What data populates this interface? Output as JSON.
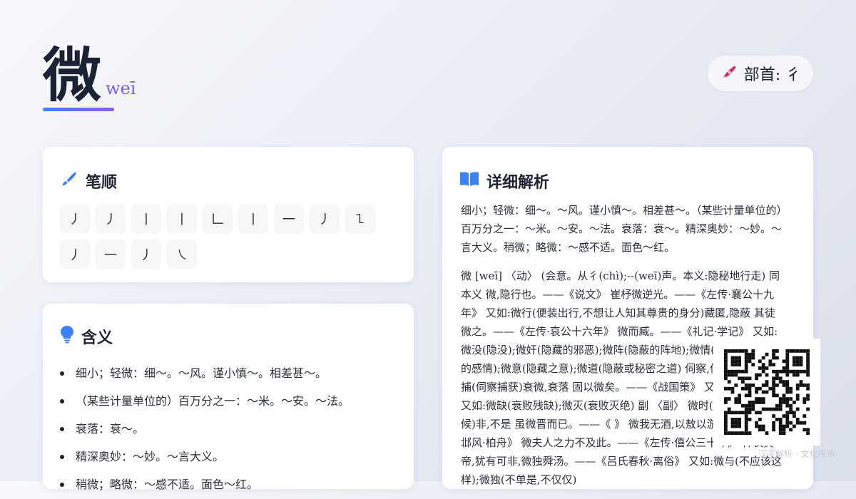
{
  "header": {
    "character": "微",
    "pinyin": "weī",
    "radical_label": "部首: 彳"
  },
  "stroke_order": {
    "title": "笔顺",
    "strokes": [
      "丿",
      "丿",
      "丨",
      "丨",
      "𠃊",
      "丨",
      "一",
      "丿",
      "㇅",
      "丿",
      "一",
      "丿",
      "㇏"
    ]
  },
  "meanings": {
    "title": "含义",
    "items": [
      "细小；轻微：细～。～风。谨小慎～。相差甚～。",
      "（某些计量单位的）百万分之一：～米。～安。～法。",
      "衰落：衰～。",
      "精深奥妙：～妙。～言大义。",
      "稍微；略微：～感不适。面色～红。"
    ]
  },
  "detail": {
    "title": "详细解析",
    "para1": "细小；轻微：细～。～风。谨小慎～。相差甚～。（某些计量单位的）百万分之一：～米。～安。～法。衰落：衰～。精深奥妙：～妙。～言大义。稍微；略微：～感不适。面色～红。",
    "para2": "微 [weī] 〈动〉 (会意。从彳(chì);--(weī)声。本义:隐秘地行走) 同本义 微,隐行也。——《说文》 崔杼微逆光。——《左传·襄公十九年》 又如:微行(便装出行,不想让人知其尊贵的身分)藏匿,隐蔽 其徒微之。——《左传·哀公十六年》 微而臧。——《礼记·学记》 又如:微没(隐没);微奸(隐藏的邪恶);微阵(隐蔽的阵地);微情(隐藏而不显露的感情);微意(隐藏之意);微道(隐蔽或秘密之道) 伺察,侦察 。 如:微捕(伺察捕获)衰微,衰落 固以微矣。——《战国策》 又:弑《教战守》 又如:微缺(衰败残缺);微灭(衰败灭绝) 副 〈副〉 微时(尚未出名的时候)非,不是 虽微晋而已。——《 》 微我无酒,以敖以游。——《诗·邶风·柏舟》 微夫人之力不及此。——《左传·僖公三十年》 神农黄帝,犹有可非,微独舜汤。——《吕氏春秋·离俗》 又如:微与(不应该这样);微独(不单是,不仅仅)"
  },
  "watermark": "汉字解析 · 文化传承",
  "colors": {
    "accent_blue": "#3b82f6",
    "accent_purple": "#8b5cf6",
    "pen_icon": "#e0245e",
    "bulb_icon": "#3b82f6"
  }
}
